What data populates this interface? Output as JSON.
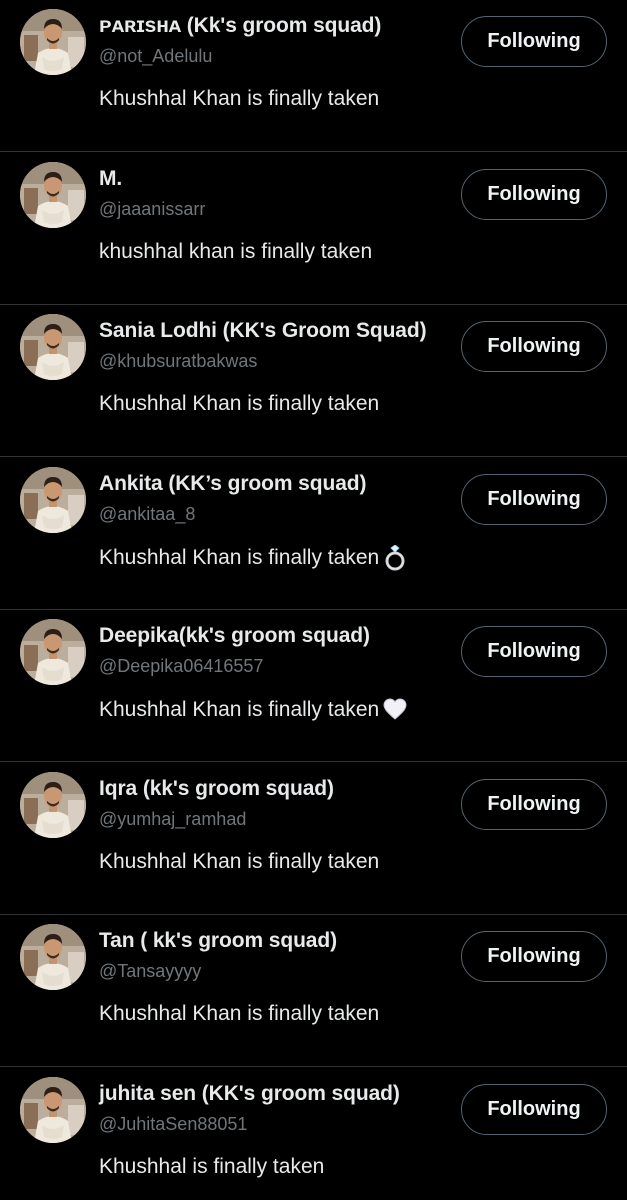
{
  "follow_button_label": "Following",
  "colors": {
    "background": "#000000",
    "primary_text": "#e7e9ea",
    "secondary_text": "#71767b",
    "divider": "#2f3336",
    "button_border": "#536471"
  },
  "users": [
    {
      "name": "ᴘᴀʀɪsʜᴀ (Kk's groom squad)",
      "handle": "@not_Adelulu",
      "text": "Khushhal Khan is finally taken",
      "emoji": ""
    },
    {
      "name": "M.",
      "handle": "@jaaanissarr",
      "text": "khushhal khan is finally taken",
      "emoji": ""
    },
    {
      "name": "Sania Lodhi (KK's Groom Squad)",
      "handle": "@khubsuratbakwas",
      "text": "Khushhal Khan is finally taken",
      "emoji": ""
    },
    {
      "name": "Ankita (KK’s groom squad)",
      "handle": "@ankitaa_8",
      "text": "Khushhal Khan is finally taken",
      "emoji": "ring-icon"
    },
    {
      "name": "Deepika(kk's groom squad)",
      "handle": "@Deepika06416557",
      "text": "Khushhal Khan is finally taken",
      "emoji": "white-heart-icon"
    },
    {
      "name": "Iqra (kk's groom squad)",
      "handle": "@yumhaj_ramhad",
      "text": "Khushhal Khan is finally taken",
      "emoji": ""
    },
    {
      "name": "Tan ( kk's groom squad)",
      "handle": "@Tansayyyy",
      "text": "Khushhal Khan is finally taken",
      "emoji": ""
    },
    {
      "name": "juhita sen (KK's groom squad)",
      "handle": "@JuhitaSen88051",
      "text": "Khushhal is finally taken",
      "emoji": ""
    }
  ]
}
